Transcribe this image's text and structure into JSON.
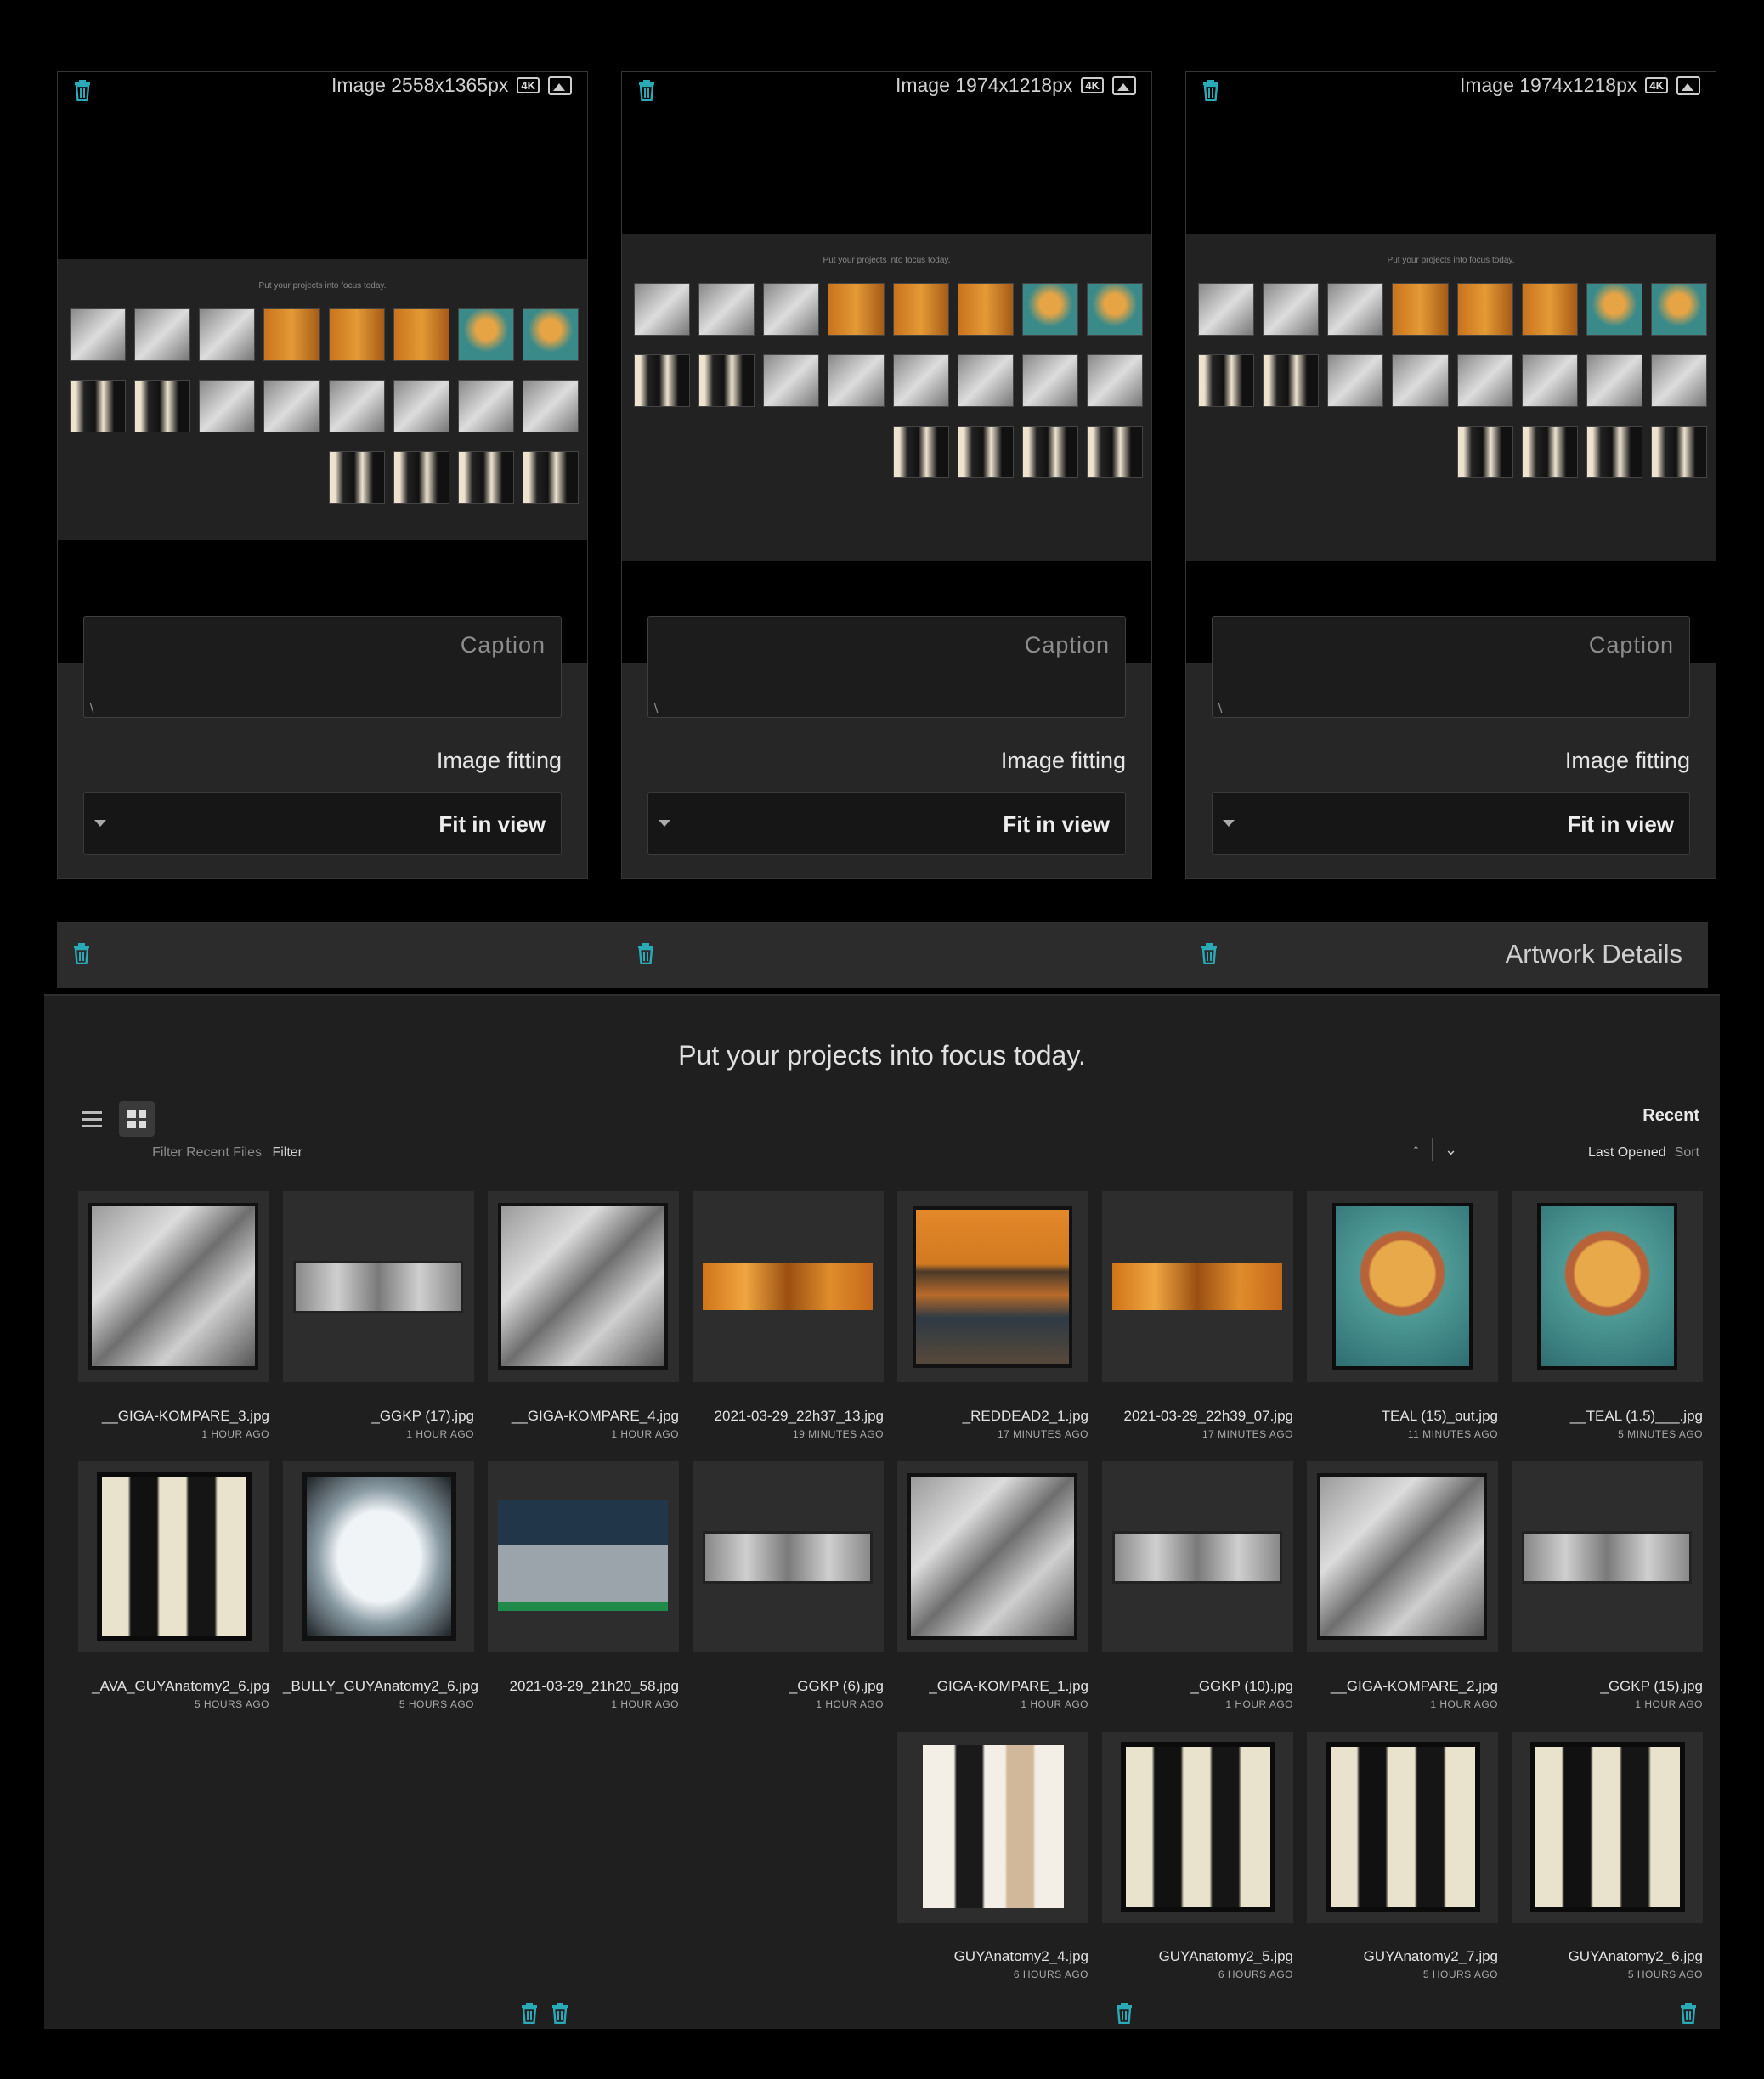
{
  "panels": [
    {
      "dimensions": "Image 2558x1365px",
      "badge": "4K",
      "caption_placeholder": "Caption",
      "fit_label": "Image fitting",
      "fit_value": "Fit in view",
      "mini_title": "Put your projects into focus today."
    },
    {
      "dimensions": "Image 1974x1218px",
      "badge": "4K",
      "caption_placeholder": "Caption",
      "fit_label": "Image fitting",
      "fit_value": "Fit in view",
      "mini_title": "Put your projects into focus today."
    },
    {
      "dimensions": "Image 1974x1218px",
      "badge": "4K",
      "caption_placeholder": "Caption",
      "fit_label": "Image fitting",
      "fit_value": "Fit in view",
      "mini_title": "Put your projects into focus today."
    }
  ],
  "details_bar": {
    "title": "Artwork Details"
  },
  "home": {
    "tagline": "Put your projects into focus today.",
    "recent_label": "Recent",
    "filter_label": "Filter",
    "filter_placeholder": "Filter Recent Files",
    "sort_label": "Sort",
    "sort_value": "Last Opened"
  },
  "files": [
    {
      "name": "__GIGA-KOMPARE_3.jpg",
      "time": "1 HOUR AGO",
      "art": "gray"
    },
    {
      "name": "_GGKP (17).jpg",
      "time": "1 HOUR AGO",
      "art": "grayband"
    },
    {
      "name": "__GIGA-KOMPARE_4.jpg",
      "time": "1 HOUR AGO",
      "art": "gray"
    },
    {
      "name": "2021-03-29_22h37_13.jpg",
      "time": "19 MINUTES AGO",
      "art": "orangeband"
    },
    {
      "name": "_REDDEAD2_1.jpg",
      "time": "17 MINUTES AGO",
      "art": "orange"
    },
    {
      "name": "2021-03-29_22h39_07.jpg",
      "time": "17 MINUTES AGO",
      "art": "orangeband"
    },
    {
      "name": "TEAL (15)_out.jpg",
      "time": "11 MINUTES AGO",
      "art": "teal"
    },
    {
      "name": "__TEAL (1.5)___.jpg",
      "time": "5 MINUTES AGO",
      "art": "teal"
    },
    {
      "name": "_AVA_GUYAnatomy2_6.jpg",
      "time": "5 HOURS AGO",
      "art": "people"
    },
    {
      "name": "_BULLY_GUYAnatomy2_6.jpg",
      "time": "5 HOURS AGO",
      "art": "white"
    },
    {
      "name": "2021-03-29_21h20_58.jpg",
      "time": "1 HOUR AGO",
      "art": "ui"
    },
    {
      "name": "_GGKP (6).jpg",
      "time": "1 HOUR AGO",
      "art": "grayband"
    },
    {
      "name": "_GIGA-KOMPARE_1.jpg",
      "time": "1 HOUR AGO",
      "art": "gray"
    },
    {
      "name": "_GGKP (10).jpg",
      "time": "1 HOUR AGO",
      "art": "grayband"
    },
    {
      "name": "__GIGA-KOMPARE_2.jpg",
      "time": "1 HOUR AGO",
      "art": "gray"
    },
    {
      "name": "_GGKP (15).jpg",
      "time": "1 HOUR AGO",
      "art": "grayband"
    },
    {
      "name": "GUYAnatomy2_4.jpg",
      "time": "6 HOURS AGO",
      "art": "peoplelight"
    },
    {
      "name": "GUYAnatomy2_5.jpg",
      "time": "6 HOURS AGO",
      "art": "people"
    },
    {
      "name": "GUYAnatomy2_7.jpg",
      "time": "5 HOURS AGO",
      "art": "people"
    },
    {
      "name": "GUYAnatomy2_6.jpg",
      "time": "5 HOURS AGO",
      "art": "people"
    }
  ],
  "icons": [
    "trash-icon",
    "download-icon",
    "image-icon",
    "list-view-icon",
    "grid-view-icon",
    "sort-arrow-icon",
    "chevron-down-icon"
  ],
  "colors": {
    "trash": "#2aa9b6",
    "background": "#1f1f1f",
    "panel": "#262626"
  }
}
